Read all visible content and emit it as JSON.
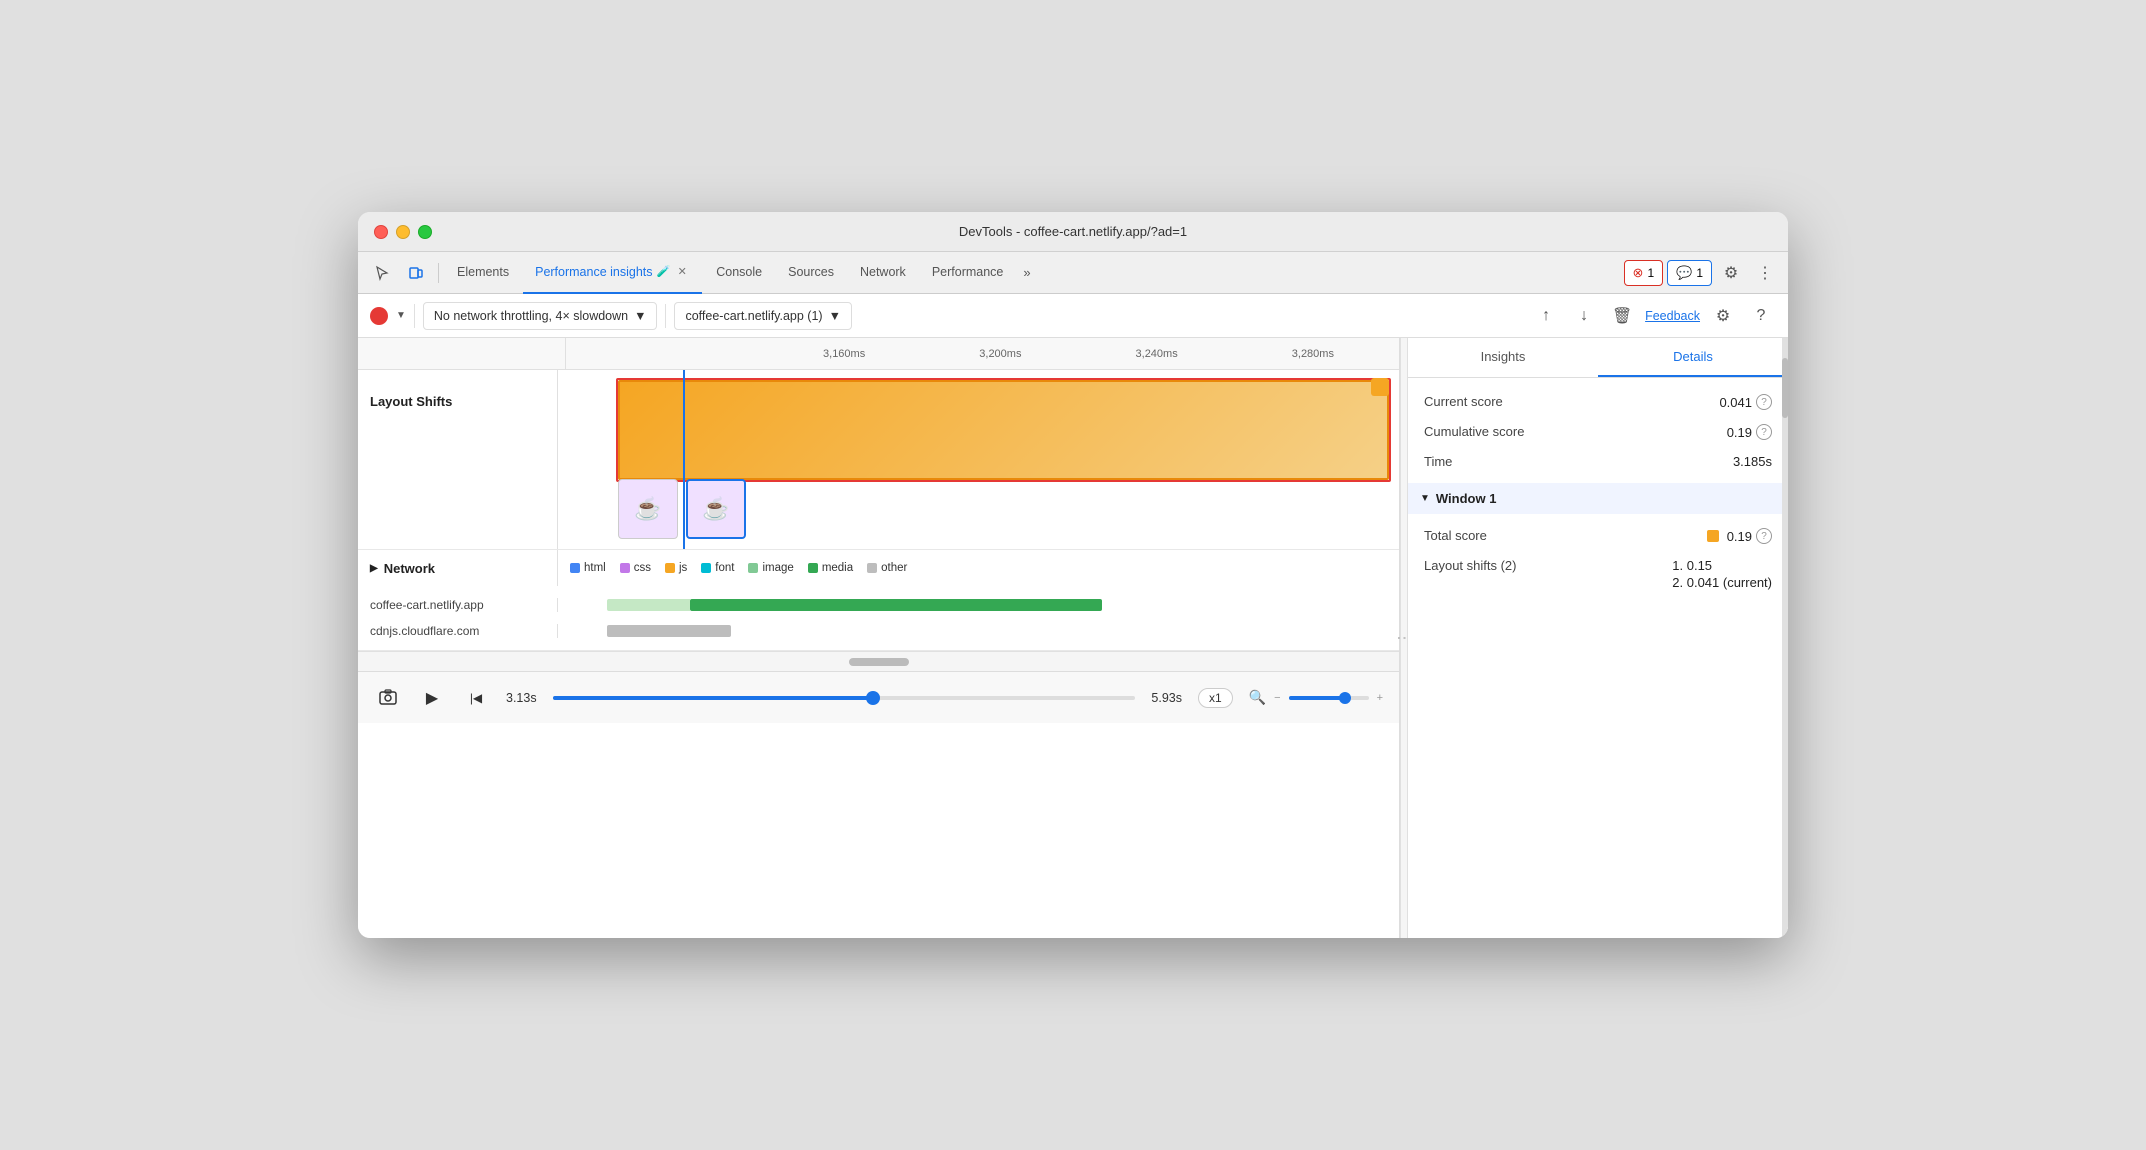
{
  "window": {
    "title": "DevTools - coffee-cart.netlify.app/?ad=1"
  },
  "tabs": {
    "items": [
      {
        "id": "elements",
        "label": "Elements",
        "active": false
      },
      {
        "id": "performance-insights",
        "label": "Performance insights",
        "active": true,
        "has_icon": true,
        "has_close": true
      },
      {
        "id": "console",
        "label": "Console",
        "active": false
      },
      {
        "id": "sources",
        "label": "Sources",
        "active": false
      },
      {
        "id": "network",
        "label": "Network",
        "active": false
      },
      {
        "id": "performance",
        "label": "Performance",
        "active": false
      }
    ],
    "more_label": "»",
    "badge_error": {
      "count": "1",
      "icon": "✕"
    },
    "badge_info": {
      "count": "1",
      "icon": "≡"
    },
    "settings_icon": "⚙",
    "more_icon": "⋮"
  },
  "toolbar": {
    "throttle_label": "No network throttling, 4× slowdown",
    "url_label": "coffee-cart.netlify.app (1)",
    "feedback_label": "Feedback",
    "upload_icon": "↑",
    "download_icon": "↓",
    "delete_icon": "🗑",
    "settings_icon": "⚙",
    "help_icon": "?"
  },
  "timeline": {
    "ticks": [
      "3,160ms",
      "3,200ms",
      "3,240ms",
      "3,280ms"
    ]
  },
  "chart": {
    "layout_shifts_label": "Layout Shifts",
    "current_score_label": "Current score",
    "cumulative_score_label": "Cumulative score",
    "time_label": "Time"
  },
  "network": {
    "label": "Network",
    "legend": [
      {
        "id": "html",
        "label": "html",
        "color": "#4285f4"
      },
      {
        "id": "css",
        "label": "css",
        "color": "#c278e8"
      },
      {
        "id": "js",
        "label": "js",
        "color": "#f5a623"
      },
      {
        "id": "font",
        "label": "font",
        "color": "#00bcd4"
      },
      {
        "id": "image",
        "label": "image",
        "color": "#81c995"
      },
      {
        "id": "media",
        "label": "media",
        "color": "#34a853"
      },
      {
        "id": "other",
        "label": "other",
        "color": "#bdbdbd"
      }
    ],
    "domains": [
      {
        "name": "coffee-cart.netlify.app",
        "bar_left": "5%",
        "bar_width": "55%",
        "bar_color": "#81c995"
      },
      {
        "name": "cdnjs.cloudflare.com",
        "bar_left": "5%",
        "bar_width": "20%",
        "bar_color": "#bdbdbd"
      }
    ]
  },
  "playback": {
    "screenshot_icon": "⊡",
    "play_icon": "▶",
    "start_icon": "|◀",
    "time_start": "3.13s",
    "time_end": "5.93s",
    "speed": "x1",
    "zoom_in_icon": "−",
    "zoom_out_icon": "+"
  },
  "right_panel": {
    "tabs": [
      {
        "id": "insights",
        "label": "Insights",
        "active": false
      },
      {
        "id": "details",
        "label": "Details",
        "active": true
      }
    ],
    "details": {
      "current_score_label": "Current score",
      "current_score_value": "0.041",
      "cumulative_score_label": "Cumulative score",
      "cumulative_score_value": "0.19",
      "time_label": "Time",
      "time_value": "3.185s",
      "window_section": "Window 1",
      "total_score_label": "Total score",
      "total_score_value": "0.19",
      "layout_shifts_label": "Layout shifts (2)",
      "layout_shifts": [
        {
          "index": "1.",
          "value": "0.15"
        },
        {
          "index": "2.",
          "value": "0.041 (current)"
        }
      ]
    }
  }
}
